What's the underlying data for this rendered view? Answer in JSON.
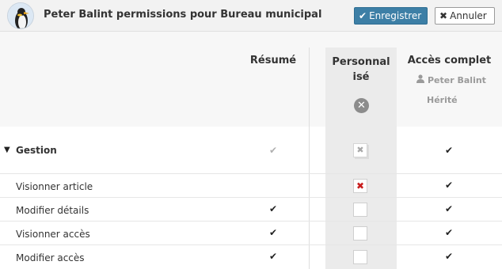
{
  "header": {
    "title": "Peter Balint permissions pour Bureau municipal",
    "save_label": "Enregistrer",
    "cancel_label": "Annuler"
  },
  "columns": {
    "summary": "Résumé",
    "personalized_line1": "Personnal",
    "personalized_line2": "isé",
    "full_access": "Accès complet",
    "full_access_user": "Peter Balint",
    "full_access_inherited": "Hérité"
  },
  "rows": [
    {
      "label": "Gestion",
      "group": true,
      "summary": "check-grey",
      "personalized": "disabled-x",
      "full_access": "check"
    },
    {
      "label": "Visionner article",
      "summary": "",
      "personalized": "red-x",
      "full_access": "check"
    },
    {
      "label": "Modifier détails",
      "summary": "check",
      "personalized": "empty",
      "full_access": "check"
    },
    {
      "label": "Visionner accès",
      "summary": "check",
      "personalized": "empty",
      "full_access": "check"
    },
    {
      "label": "Modifier accès",
      "summary": "check",
      "personalized": "empty",
      "full_access": "check"
    }
  ],
  "colors": {
    "primary": "#3d7fa6",
    "deny": "#c81d1d"
  }
}
